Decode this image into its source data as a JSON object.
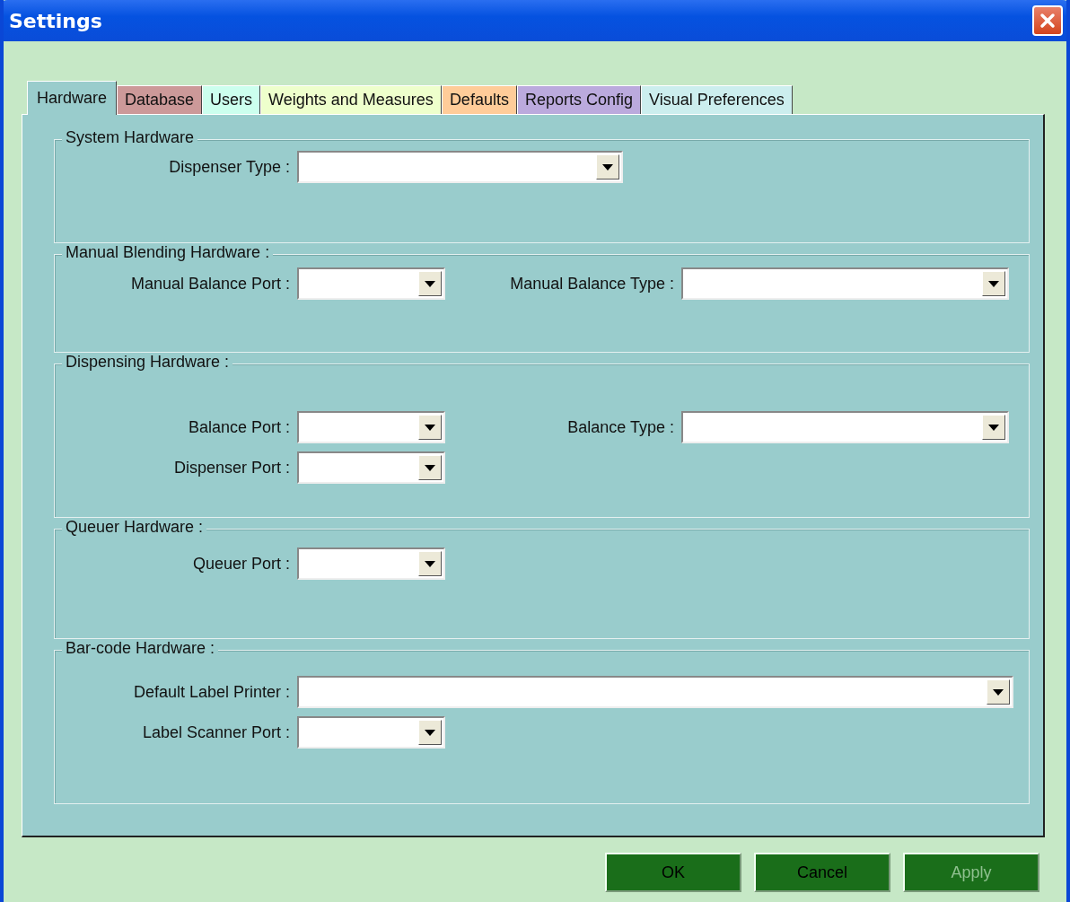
{
  "window": {
    "title": "Settings"
  },
  "tabs": [
    {
      "label": "Hardware",
      "selected": true,
      "color": "#99cccc"
    },
    {
      "label": "Database",
      "selected": false,
      "color": "#cc9999"
    },
    {
      "label": "Users",
      "selected": false,
      "color": "#ccffee"
    },
    {
      "label": "Weights and Measures",
      "selected": false,
      "color": "#eeffcc"
    },
    {
      "label": "Defaults",
      "selected": false,
      "color": "#ffcc99"
    },
    {
      "label": "Reports Config",
      "selected": false,
      "color": "#bbaadd"
    },
    {
      "label": "Visual Preferences",
      "selected": false,
      "color": "#cceeee"
    }
  ],
  "groups": [
    {
      "title": "System Hardware",
      "rows": [
        [
          {
            "label": "Dispenser Type :"
          }
        ]
      ]
    },
    {
      "title": "Manual Blending Hardware :",
      "rows": [
        [
          {
            "label": "Manual Balance Port :"
          },
          {
            "label": "Manual Balance Type :"
          }
        ]
      ]
    },
    {
      "title": "Dispensing Hardware :",
      "rows": [
        [
          {
            "label": "Balance Port :"
          },
          {
            "label": "Balance Type :"
          }
        ],
        [
          {
            "label": "Dispenser Port :"
          }
        ]
      ]
    },
    {
      "title": "Queuer Hardware :",
      "rows": [
        [
          {
            "label": "Queuer Port :"
          }
        ]
      ]
    },
    {
      "title": "Bar-code Hardware :",
      "rows": [
        [
          {
            "label": "Default Label Printer :"
          }
        ],
        [
          {
            "label": "Label Scanner Port :"
          }
        ]
      ]
    }
  ],
  "buttons": [
    {
      "label": "OK",
      "disabled": false
    },
    {
      "label": "Cancel",
      "disabled": false
    },
    {
      "label": "Apply",
      "disabled": true
    }
  ]
}
